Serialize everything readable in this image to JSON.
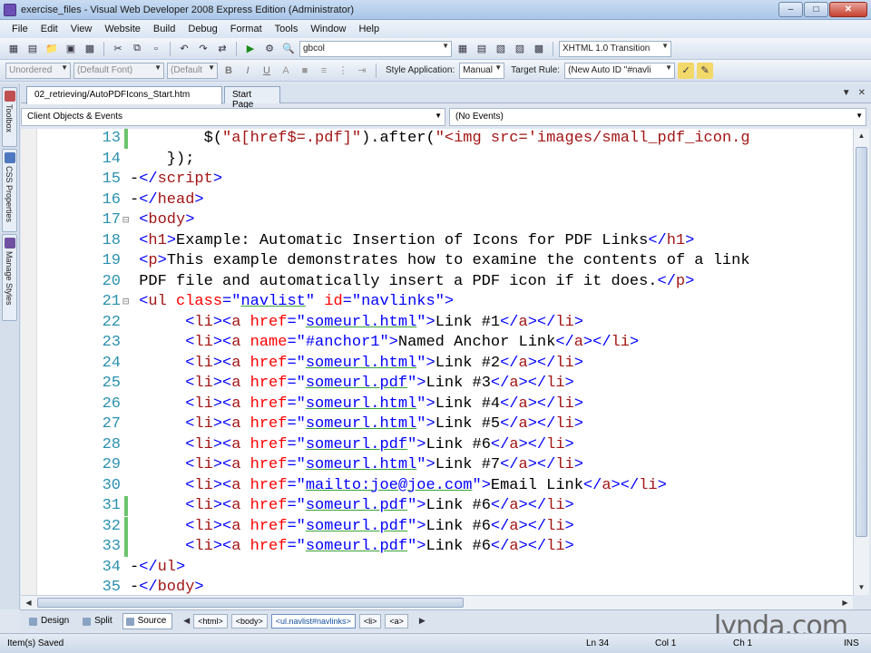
{
  "window": {
    "title": "exercise_files - Visual Web Developer 2008 Express Edition (Administrator)"
  },
  "menu": [
    "File",
    "Edit",
    "View",
    "Website",
    "Build",
    "Debug",
    "Format",
    "Tools",
    "Window",
    "Help"
  ],
  "toolbar1": {
    "combo_value": "gbcol",
    "doctype_value": "XHTML 1.0 Transition"
  },
  "toolbar2": {
    "block_format": "Unordered",
    "font_name": "(Default Font)",
    "font_size": "(Default",
    "bold": "B",
    "italic": "I",
    "underline": "U",
    "style_app_label": "Style Application:",
    "style_app_value": "Manual",
    "target_rule_label": "Target Rule:",
    "target_rule_value": "(New Auto ID \"#navli"
  },
  "side_panels": [
    "Toolbox",
    "CSS Properties",
    "Manage Styles"
  ],
  "tabs": [
    {
      "label": "02_retrieving/AutoPDFIcons_Start.htm",
      "active": true
    },
    {
      "label": "Start Page",
      "active": false
    }
  ],
  "objects_combo": "Client Objects & Events",
  "events_combo": "(No Events)",
  "code_lines": [
    {
      "num": "13",
      "saved": true,
      "fold": false,
      "parts": [
        {
          "t": "txt",
          "v": "        $("
        },
        {
          "t": "str",
          "v": "\"a[href$=.pdf]\""
        },
        {
          "t": "txt",
          "v": ").after("
        },
        {
          "t": "str",
          "v": "\"<img src='images/small_pdf_icon.g"
        }
      ]
    },
    {
      "num": "14",
      "saved": false,
      "fold": false,
      "parts": [
        {
          "t": "txt",
          "v": "    });"
        }
      ]
    },
    {
      "num": "15",
      "saved": false,
      "fold": false,
      "parts": [
        {
          "t": "txt",
          "v": "-"
        },
        {
          "t": "br",
          "v": "</"
        },
        {
          "t": "tag",
          "v": "script"
        },
        {
          "t": "br",
          "v": ">"
        }
      ]
    },
    {
      "num": "16",
      "saved": false,
      "fold": false,
      "parts": [
        {
          "t": "txt",
          "v": "-"
        },
        {
          "t": "br",
          "v": "</"
        },
        {
          "t": "tag",
          "v": "head"
        },
        {
          "t": "br",
          "v": ">"
        }
      ]
    },
    {
      "num": "17",
      "saved": false,
      "fold": true,
      "parts": [
        {
          "t": "br",
          "v": " <"
        },
        {
          "t": "tag",
          "v": "body"
        },
        {
          "t": "br",
          "v": ">"
        }
      ]
    },
    {
      "num": "18",
      "saved": false,
      "fold": false,
      "parts": [
        {
          "t": "br",
          "v": " <"
        },
        {
          "t": "tag",
          "v": "h1"
        },
        {
          "t": "br",
          "v": ">"
        },
        {
          "t": "txt",
          "v": "Example: Automatic Insertion of Icons for PDF Links"
        },
        {
          "t": "br",
          "v": "</"
        },
        {
          "t": "tag",
          "v": "h1"
        },
        {
          "t": "br",
          "v": ">"
        }
      ]
    },
    {
      "num": "19",
      "saved": false,
      "fold": false,
      "parts": [
        {
          "t": "br",
          "v": " <"
        },
        {
          "t": "tag",
          "v": "p"
        },
        {
          "t": "br",
          "v": ">"
        },
        {
          "t": "txt",
          "v": "This example demonstrates how to examine the contents of a link"
        }
      ]
    },
    {
      "num": "20",
      "saved": false,
      "fold": false,
      "parts": [
        {
          "t": "txt",
          "v": " PDF file and automatically insert a PDF icon if it does."
        },
        {
          "t": "br",
          "v": "</"
        },
        {
          "t": "tag",
          "v": "p"
        },
        {
          "t": "br",
          "v": ">"
        }
      ]
    },
    {
      "num": "21",
      "saved": false,
      "fold": true,
      "parts": [
        {
          "t": "br",
          "v": " <"
        },
        {
          "t": "tag",
          "v": "ul"
        },
        {
          "t": "attr",
          "v": " class"
        },
        {
          "t": "br",
          "v": "=\""
        },
        {
          "t": "val",
          "v": "navlist"
        },
        {
          "t": "br",
          "v": "\""
        },
        {
          "t": "attr",
          "v": " id"
        },
        {
          "t": "br",
          "v": "=\"navlinks\">"
        }
      ]
    },
    {
      "num": "22",
      "saved": false,
      "fold": false,
      "parts": [
        {
          "t": "br",
          "v": "      <"
        },
        {
          "t": "tag",
          "v": "li"
        },
        {
          "t": "br",
          "v": "><"
        },
        {
          "t": "tag",
          "v": "a"
        },
        {
          "t": "attr",
          "v": " href"
        },
        {
          "t": "br",
          "v": "=\""
        },
        {
          "t": "val",
          "v": "someurl.html"
        },
        {
          "t": "br",
          "v": "\">"
        },
        {
          "t": "txt",
          "v": "Link #1"
        },
        {
          "t": "br",
          "v": "</"
        },
        {
          "t": "tag",
          "v": "a"
        },
        {
          "t": "br",
          "v": "></"
        },
        {
          "t": "tag",
          "v": "li"
        },
        {
          "t": "br",
          "v": ">"
        }
      ]
    },
    {
      "num": "23",
      "saved": false,
      "fold": false,
      "parts": [
        {
          "t": "br",
          "v": "      <"
        },
        {
          "t": "tag",
          "v": "li"
        },
        {
          "t": "br",
          "v": "><"
        },
        {
          "t": "tag",
          "v": "a"
        },
        {
          "t": "attr",
          "v": " name"
        },
        {
          "t": "br",
          "v": "=\"#anchor1\">"
        },
        {
          "t": "txt",
          "v": "Named Anchor Link"
        },
        {
          "t": "br",
          "v": "</"
        },
        {
          "t": "tag",
          "v": "a"
        },
        {
          "t": "br",
          "v": "></"
        },
        {
          "t": "tag",
          "v": "li"
        },
        {
          "t": "br",
          "v": ">"
        }
      ]
    },
    {
      "num": "24",
      "saved": false,
      "fold": false,
      "parts": [
        {
          "t": "br",
          "v": "      <"
        },
        {
          "t": "tag",
          "v": "li"
        },
        {
          "t": "br",
          "v": "><"
        },
        {
          "t": "tag",
          "v": "a"
        },
        {
          "t": "attr",
          "v": " href"
        },
        {
          "t": "br",
          "v": "=\""
        },
        {
          "t": "val",
          "v": "someurl.html"
        },
        {
          "t": "br",
          "v": "\">"
        },
        {
          "t": "txt",
          "v": "Link #2"
        },
        {
          "t": "br",
          "v": "</"
        },
        {
          "t": "tag",
          "v": "a"
        },
        {
          "t": "br",
          "v": "></"
        },
        {
          "t": "tag",
          "v": "li"
        },
        {
          "t": "br",
          "v": ">"
        }
      ]
    },
    {
      "num": "25",
      "saved": false,
      "fold": false,
      "parts": [
        {
          "t": "br",
          "v": "      <"
        },
        {
          "t": "tag",
          "v": "li"
        },
        {
          "t": "br",
          "v": "><"
        },
        {
          "t": "tag",
          "v": "a"
        },
        {
          "t": "attr",
          "v": " href"
        },
        {
          "t": "br",
          "v": "=\""
        },
        {
          "t": "val",
          "v": "someurl.pdf"
        },
        {
          "t": "br",
          "v": "\">"
        },
        {
          "t": "txt",
          "v": "Link #3"
        },
        {
          "t": "br",
          "v": "</"
        },
        {
          "t": "tag",
          "v": "a"
        },
        {
          "t": "br",
          "v": "></"
        },
        {
          "t": "tag",
          "v": "li"
        },
        {
          "t": "br",
          "v": ">"
        }
      ]
    },
    {
      "num": "26",
      "saved": false,
      "fold": false,
      "parts": [
        {
          "t": "br",
          "v": "      <"
        },
        {
          "t": "tag",
          "v": "li"
        },
        {
          "t": "br",
          "v": "><"
        },
        {
          "t": "tag",
          "v": "a"
        },
        {
          "t": "attr",
          "v": " href"
        },
        {
          "t": "br",
          "v": "=\""
        },
        {
          "t": "val",
          "v": "someurl.html"
        },
        {
          "t": "br",
          "v": "\">"
        },
        {
          "t": "txt",
          "v": "Link #4"
        },
        {
          "t": "br",
          "v": "</"
        },
        {
          "t": "tag",
          "v": "a"
        },
        {
          "t": "br",
          "v": "></"
        },
        {
          "t": "tag",
          "v": "li"
        },
        {
          "t": "br",
          "v": ">"
        }
      ]
    },
    {
      "num": "27",
      "saved": false,
      "fold": false,
      "parts": [
        {
          "t": "br",
          "v": "      <"
        },
        {
          "t": "tag",
          "v": "li"
        },
        {
          "t": "br",
          "v": "><"
        },
        {
          "t": "tag",
          "v": "a"
        },
        {
          "t": "attr",
          "v": " href"
        },
        {
          "t": "br",
          "v": "=\""
        },
        {
          "t": "val",
          "v": "someurl.html"
        },
        {
          "t": "br",
          "v": "\">"
        },
        {
          "t": "txt",
          "v": "Link #5"
        },
        {
          "t": "br",
          "v": "</"
        },
        {
          "t": "tag",
          "v": "a"
        },
        {
          "t": "br",
          "v": "></"
        },
        {
          "t": "tag",
          "v": "li"
        },
        {
          "t": "br",
          "v": ">"
        }
      ]
    },
    {
      "num": "28",
      "saved": false,
      "fold": false,
      "parts": [
        {
          "t": "br",
          "v": "      <"
        },
        {
          "t": "tag",
          "v": "li"
        },
        {
          "t": "br",
          "v": "><"
        },
        {
          "t": "tag",
          "v": "a"
        },
        {
          "t": "attr",
          "v": " href"
        },
        {
          "t": "br",
          "v": "=\""
        },
        {
          "t": "val",
          "v": "someurl.pdf"
        },
        {
          "t": "br",
          "v": "\">"
        },
        {
          "t": "txt",
          "v": "Link #6"
        },
        {
          "t": "br",
          "v": "</"
        },
        {
          "t": "tag",
          "v": "a"
        },
        {
          "t": "br",
          "v": "></"
        },
        {
          "t": "tag",
          "v": "li"
        },
        {
          "t": "br",
          "v": ">"
        }
      ]
    },
    {
      "num": "29",
      "saved": false,
      "fold": false,
      "parts": [
        {
          "t": "br",
          "v": "      <"
        },
        {
          "t": "tag",
          "v": "li"
        },
        {
          "t": "br",
          "v": "><"
        },
        {
          "t": "tag",
          "v": "a"
        },
        {
          "t": "attr",
          "v": " href"
        },
        {
          "t": "br",
          "v": "=\""
        },
        {
          "t": "val",
          "v": "someurl.html"
        },
        {
          "t": "br",
          "v": "\">"
        },
        {
          "t": "txt",
          "v": "Link #7"
        },
        {
          "t": "br",
          "v": "</"
        },
        {
          "t": "tag",
          "v": "a"
        },
        {
          "t": "br",
          "v": "></"
        },
        {
          "t": "tag",
          "v": "li"
        },
        {
          "t": "br",
          "v": ">"
        }
      ]
    },
    {
      "num": "30",
      "saved": false,
      "fold": false,
      "parts": [
        {
          "t": "br",
          "v": "      <"
        },
        {
          "t": "tag",
          "v": "li"
        },
        {
          "t": "br",
          "v": "><"
        },
        {
          "t": "tag",
          "v": "a"
        },
        {
          "t": "attr",
          "v": " href"
        },
        {
          "t": "br",
          "v": "=\""
        },
        {
          "t": "val",
          "v": "mailto:joe@joe.com"
        },
        {
          "t": "br",
          "v": "\">"
        },
        {
          "t": "txt",
          "v": "Email Link"
        },
        {
          "t": "br",
          "v": "</"
        },
        {
          "t": "tag",
          "v": "a"
        },
        {
          "t": "br",
          "v": "></"
        },
        {
          "t": "tag",
          "v": "li"
        },
        {
          "t": "br",
          "v": ">"
        }
      ]
    },
    {
      "num": "31",
      "saved": true,
      "fold": false,
      "parts": [
        {
          "t": "br",
          "v": "      <"
        },
        {
          "t": "tag",
          "v": "li"
        },
        {
          "t": "br",
          "v": "><"
        },
        {
          "t": "tag",
          "v": "a"
        },
        {
          "t": "attr",
          "v": " href"
        },
        {
          "t": "br",
          "v": "=\""
        },
        {
          "t": "val",
          "v": "someurl.pdf"
        },
        {
          "t": "br",
          "v": "\">"
        },
        {
          "t": "txt",
          "v": "Link #6"
        },
        {
          "t": "br",
          "v": "</"
        },
        {
          "t": "tag",
          "v": "a"
        },
        {
          "t": "br",
          "v": "></"
        },
        {
          "t": "tag",
          "v": "li"
        },
        {
          "t": "br",
          "v": ">"
        }
      ]
    },
    {
      "num": "32",
      "saved": true,
      "fold": false,
      "parts": [
        {
          "t": "br",
          "v": "      <"
        },
        {
          "t": "tag",
          "v": "li"
        },
        {
          "t": "br",
          "v": "><"
        },
        {
          "t": "tag",
          "v": "a"
        },
        {
          "t": "attr",
          "v": " href"
        },
        {
          "t": "br",
          "v": "=\""
        },
        {
          "t": "val",
          "v": "someurl.pdf"
        },
        {
          "t": "br",
          "v": "\">"
        },
        {
          "t": "txt",
          "v": "Link #6"
        },
        {
          "t": "br",
          "v": "</"
        },
        {
          "t": "tag",
          "v": "a"
        },
        {
          "t": "br",
          "v": "></"
        },
        {
          "t": "tag",
          "v": "li"
        },
        {
          "t": "br",
          "v": ">"
        }
      ]
    },
    {
      "num": "33",
      "saved": true,
      "fold": false,
      "parts": [
        {
          "t": "br",
          "v": "      <"
        },
        {
          "t": "tag",
          "v": "li"
        },
        {
          "t": "br",
          "v": "><"
        },
        {
          "t": "tag",
          "v": "a"
        },
        {
          "t": "attr",
          "v": " href"
        },
        {
          "t": "br",
          "v": "=\""
        },
        {
          "t": "val",
          "v": "someurl.pdf"
        },
        {
          "t": "br",
          "v": "\">"
        },
        {
          "t": "txt",
          "v": "Link #6"
        },
        {
          "t": "br",
          "v": "</"
        },
        {
          "t": "tag",
          "v": "a"
        },
        {
          "t": "br",
          "v": "></"
        },
        {
          "t": "tag",
          "v": "li"
        },
        {
          "t": "br",
          "v": ">"
        }
      ]
    },
    {
      "num": "34",
      "saved": false,
      "fold": false,
      "parts": [
        {
          "t": "txt",
          "v": "-"
        },
        {
          "t": "br",
          "v": "</"
        },
        {
          "t": "tag",
          "v": "ul"
        },
        {
          "t": "br",
          "v": ">"
        }
      ]
    },
    {
      "num": "35",
      "saved": false,
      "fold": false,
      "parts": [
        {
          "t": "txt",
          "v": "-"
        },
        {
          "t": "br",
          "v": "</"
        },
        {
          "t": "tag",
          "v": "body"
        },
        {
          "t": "br",
          "v": ">"
        }
      ]
    }
  ],
  "view_buttons": [
    {
      "label": "Design",
      "active": false
    },
    {
      "label": "Split",
      "active": false
    },
    {
      "label": "Source",
      "active": true
    }
  ],
  "breadcrumbs": [
    {
      "label": "<html>",
      "selected": false
    },
    {
      "label": "<body>",
      "selected": false
    },
    {
      "label": "<ul.navlist#navlinks>",
      "selected": true
    },
    {
      "label": "<li>",
      "selected": false
    },
    {
      "label": "<a>",
      "selected": false
    }
  ],
  "watermark": "lynda.com",
  "status": {
    "message": "Item(s) Saved",
    "line": "Ln 34",
    "col": "Col 1",
    "ch": "Ch 1",
    "mode": "INS"
  },
  "colors": {
    "tag": "#a31515",
    "attr": "#ff0000",
    "bracket": "#0000ff",
    "line_number": "#2b91af",
    "saved_marker": "#6cc46c"
  }
}
